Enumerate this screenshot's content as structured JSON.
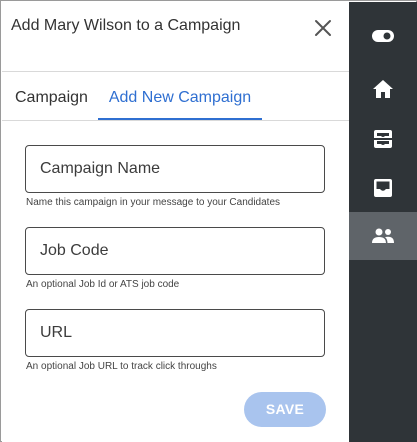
{
  "dialog": {
    "title": "Add Mary Wilson to a Campaign"
  },
  "tabs": [
    {
      "label": "Campaign",
      "active": false
    },
    {
      "label": "Add New Campaign",
      "active": true
    }
  ],
  "form": {
    "campaign_name": {
      "value": "",
      "placeholder": "Campaign Name",
      "help": "Name this campaign in your message to your Candidates"
    },
    "job_code": {
      "value": "",
      "placeholder": "Job Code",
      "help": "An optional Job Id or ATS job code"
    },
    "url": {
      "value": "",
      "placeholder": "URL",
      "help": "An optional Job URL to track click throughs"
    },
    "save_label": "SAVE"
  },
  "sidebar": {
    "items": [
      {
        "icon": "toggle-icon",
        "active": false
      },
      {
        "icon": "home-icon",
        "active": false
      },
      {
        "icon": "inbox-archive-icon",
        "active": false
      },
      {
        "icon": "inbox-icon",
        "active": false
      },
      {
        "icon": "people-icon",
        "active": true
      }
    ]
  },
  "colors": {
    "accent": "#2f6fd1",
    "save_button_disabled": "#a9c4ee",
    "sidebar_bg": "#2f3438",
    "sidebar_active_bg": "#5f6469"
  }
}
